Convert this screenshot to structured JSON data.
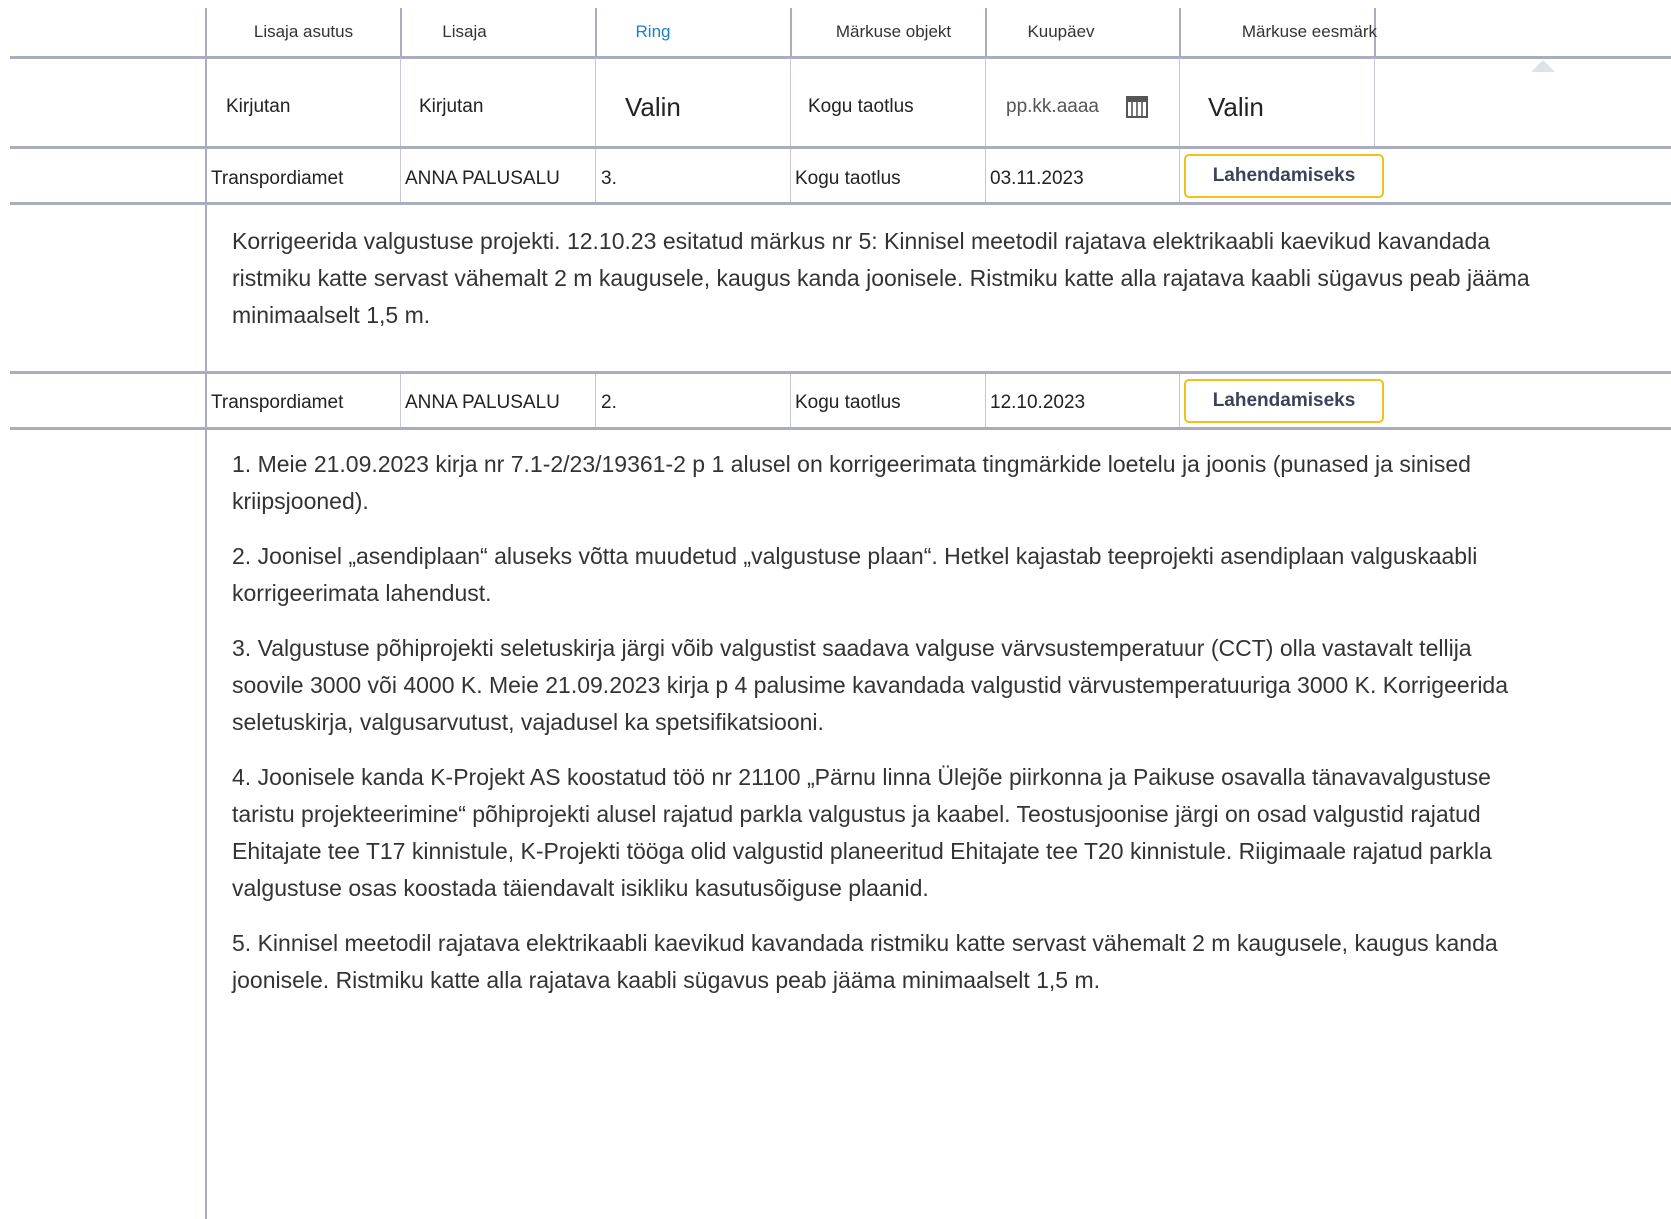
{
  "header": {
    "columns": [
      "Lisaja asutus",
      "Lisaja",
      "Ring",
      "Märkuse objekt",
      "Kuupäev",
      "Märkuse eesmärk"
    ]
  },
  "filters": {
    "lisaja_asutus": "Kirjutan",
    "lisaja": "Kirjutan",
    "ring": "Valin",
    "markuse_objekt": "Kogu taotlus",
    "kuupaev_placeholder": "pp.kk.aaaa",
    "markuse_eesmark": "Valin"
  },
  "rows": [
    {
      "asutus": "Transpordiamet",
      "lisaja": "ANNA PALUSALU",
      "ring": "3.",
      "objekt": "Kogu taotlus",
      "kuupaev": "03.11.2023",
      "eesmark": "Lahendamiseks",
      "text": [
        "Korrigeerida valgustuse projekti. 12.10.23 esitatud märkus nr 5: Kinnisel meetodil rajatava elektrikaabli kaevikud kavandada ristmiku katte servast vähemalt 2 m kaugusele, kaugus kanda joonisele. Ristmiku katte alla rajatava kaabli sügavus peab jääma minimaalselt 1,5 m."
      ]
    },
    {
      "asutus": "Transpordiamet",
      "lisaja": "ANNA PALUSALU",
      "ring": "2.",
      "objekt": "Kogu taotlus",
      "kuupaev": "12.10.2023",
      "eesmark": "Lahendamiseks",
      "text": [
        "1. Meie 21.09.2023  kirja nr 7.1-2/23/19361-2 p 1 alusel on korrigeerimata tingmärkide loetelu ja joonis (punased ja sinised kriipsjooned).",
        "2. Joonisel „asendiplaan“ aluseks võtta muudetud „valgustuse plaan“. Hetkel kajastab teeprojekti asendiplaan valguskaabli korrigeerimata lahendust.",
        "3. Valgustuse põhiprojekti seletuskirja järgi võib valgustist saadava valguse värvsustemperatuur (CCT) olla vastavalt tellija soovile 3000 või 4000 K. Meie 21.09.2023  kirja p 4 palusime kavandada valgustid värvustemperatuuriga 3000 K. Korrigeerida seletuskirja, valgusarvutust, vajadusel  ka spetsifikatsiooni.",
        "4. Joonisele kanda K-Projekt AS koostatud töö nr 21100 „Pärnu linna Ülejõe piirkonna ja Paikuse osavalla tänavavalgustuse taristu projekteerimine“ põhiprojekti alusel rajatud parkla valgustus ja kaabel. Teostusjoonise järgi on osad valgustid rajatud Ehitajate tee T17 kinnistule, K-Projekti tööga olid valgustid planeeritud Ehitajate tee T20 kinnistule. Riigimaale rajatud parkla valgustuse osas koostada täiendavalt isikliku kasutusõiguse plaanid.",
        "5. Kinnisel meetodil rajatava elektrikaabli kaevikud kavandada ristmiku katte servast vähemalt 2 m kaugusele, kaugus kanda joonisele. Ristmiku katte alla rajatava kaabli sügavus peab jääma minimaalselt 1,5 m."
      ]
    }
  ]
}
